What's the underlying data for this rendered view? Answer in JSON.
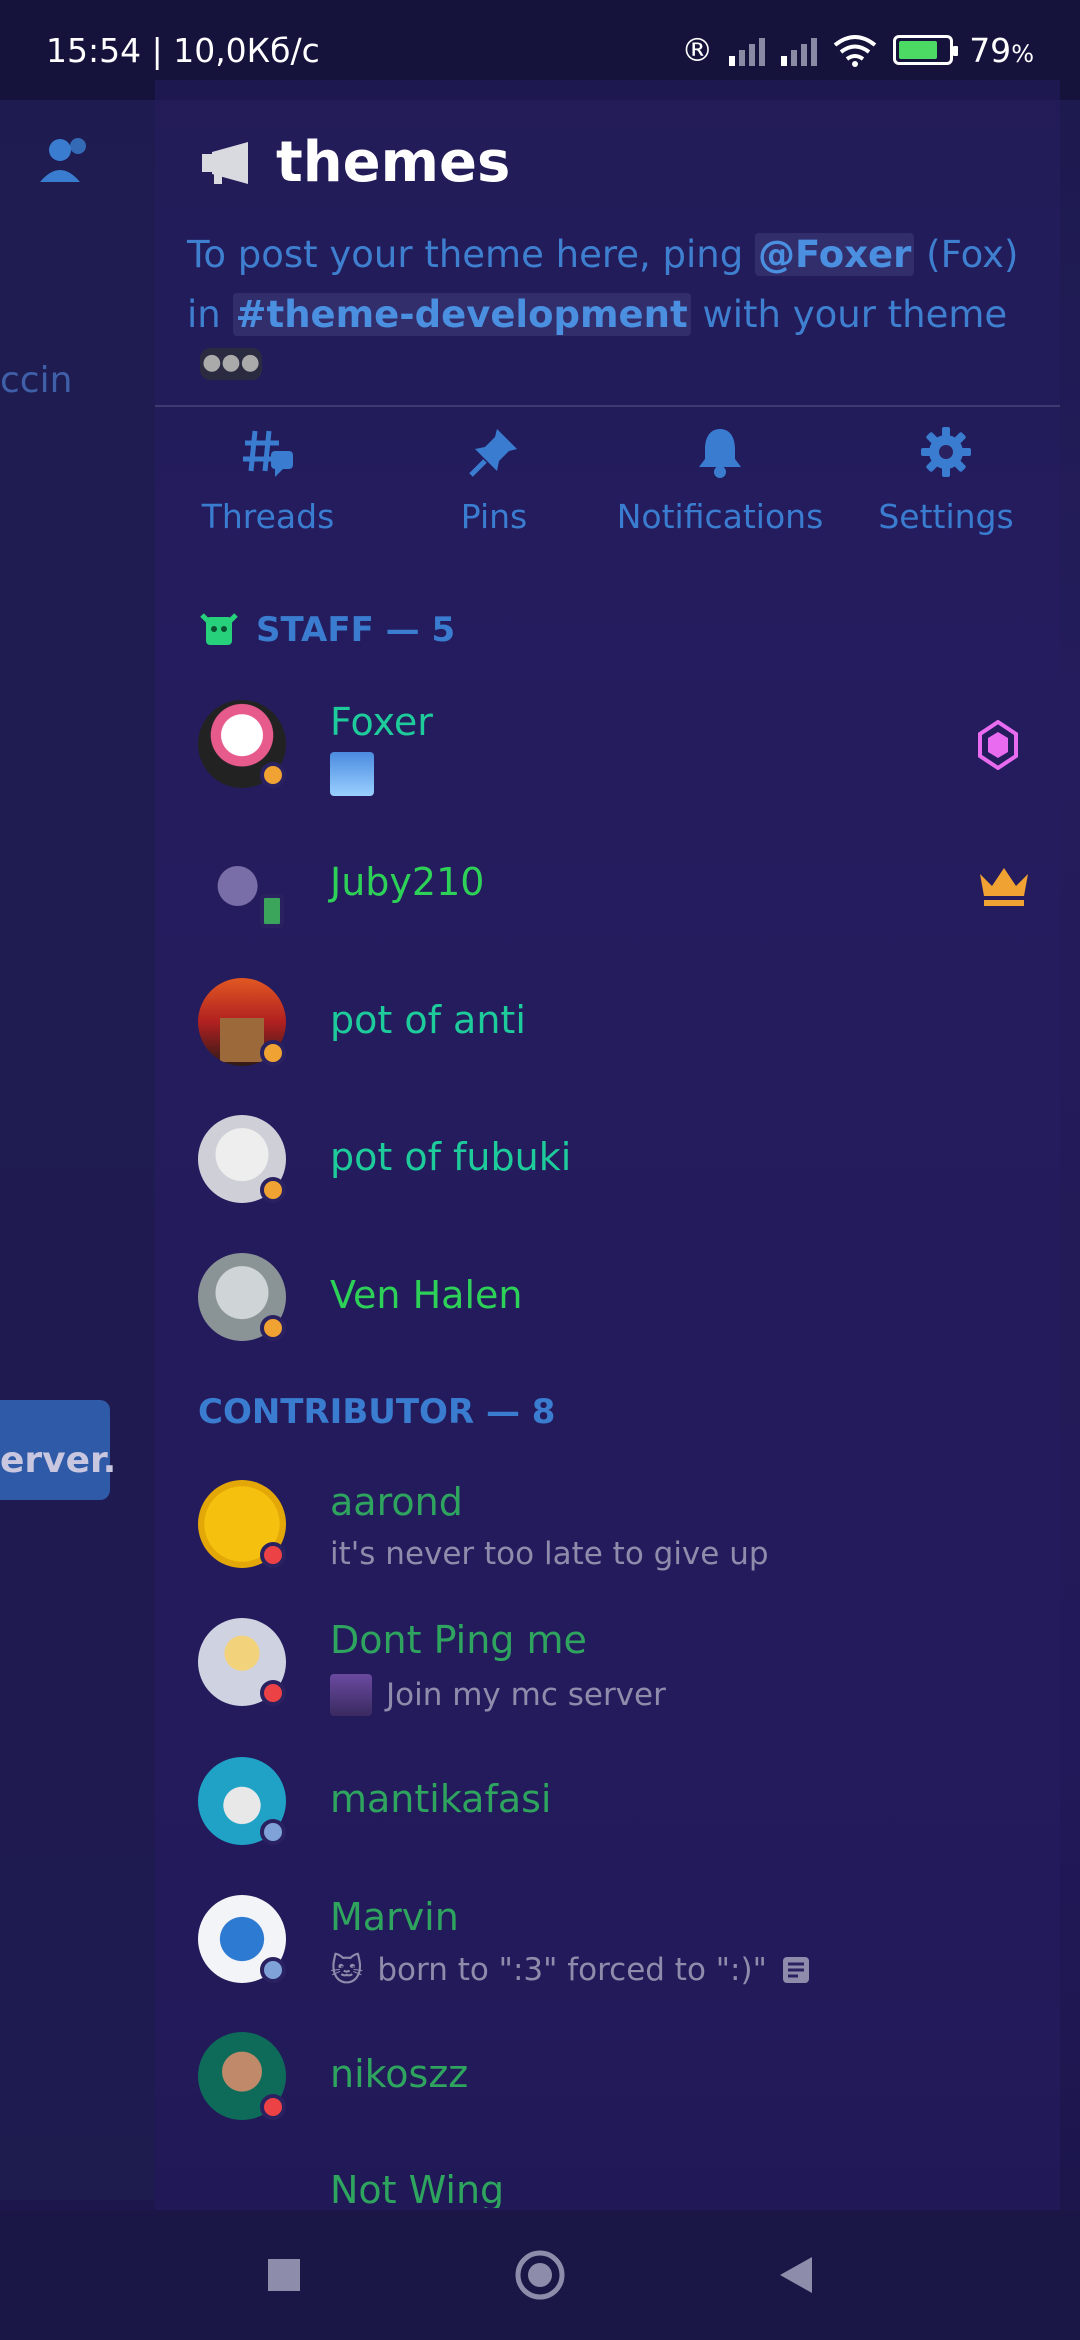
{
  "status_bar": {
    "time_speed": "15:54 | 10,0Кб/с",
    "battery_percent": "79",
    "battery_unit": "%",
    "battery_level": 0.79
  },
  "left_panel": {
    "partial_text_1": "ccin",
    "partial_text_2": "erver."
  },
  "channel": {
    "name": "themes",
    "topic_pre": "To post your theme here, ping ",
    "topic_mention_user": "@Foxer",
    "topic_mid": " (Fox) in ",
    "topic_mention_channel": "#theme-development",
    "topic_post": " with your theme"
  },
  "actions": [
    {
      "label": "Threads"
    },
    {
      "label": "Pins"
    },
    {
      "label": "Notifications"
    },
    {
      "label": "Settings"
    }
  ],
  "sections": {
    "staff": "STAFF — 5",
    "contributor": "CONTRIBUTOR — 8"
  },
  "members": {
    "staff": [
      {
        "name": "Foxer",
        "color": "#1ecb9b",
        "status": "idle",
        "badge": "boost-icon"
      },
      {
        "name": "Juby210",
        "color": "#2ed158",
        "status": "mobile",
        "badge": "crown-icon"
      },
      {
        "name": "pot of anti",
        "color": "#1ecb9b",
        "status": "idle"
      },
      {
        "name": "pot of fubuki",
        "color": "#1ecb9b",
        "status": "idle"
      },
      {
        "name": "Ven Halen",
        "color": "#2ed158",
        "status": "idle"
      }
    ],
    "contributor": [
      {
        "name": "aarond",
        "color": "#2ea45e",
        "status": "dnd",
        "subtitle": "it's never too late to give up"
      },
      {
        "name": "Dont Ping me",
        "color": "#2ea45e",
        "status": "dnd",
        "subtitle": "Join my mc server"
      },
      {
        "name": "mantikafasi",
        "color": "#2ea45e",
        "status": "offline"
      },
      {
        "name": "Marvin",
        "color": "#2ea45e",
        "status": "offline",
        "subtitle": "born to \":3\" forced to \":)\""
      },
      {
        "name": "nikoszz",
        "color": "#2ea45e",
        "status": "dnd"
      },
      {
        "name": "Not Wing",
        "color": "#2ea45e"
      }
    ]
  },
  "colors": {
    "accent": "#3a7dd0",
    "idle": "#f0a232",
    "dnd": "#ed4245",
    "offline": "#7fa3d8",
    "mobile": "#3ba55c"
  }
}
